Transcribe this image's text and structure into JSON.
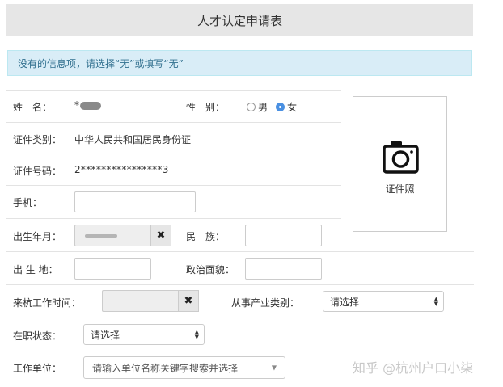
{
  "header": {
    "title": "人才认定申请表"
  },
  "notice": {
    "text": "没有的信息项，请选择“无”或填写“无”"
  },
  "fields": {
    "name": {
      "label": "姓　名：",
      "value": "*"
    },
    "gender": {
      "label": "性　别：",
      "options": [
        "男",
        "女"
      ],
      "selected": "女"
    },
    "id_type": {
      "label": "证件类别：",
      "value": "中华人民共和国居民身份证"
    },
    "id_number": {
      "label": "证件号码：",
      "value": "2****************3"
    },
    "phone": {
      "label": "手机：",
      "value": ""
    },
    "birth_date": {
      "label": "出生年月：",
      "value": "",
      "clear": "✖"
    },
    "ethnicity": {
      "label": "民　族：",
      "value": ""
    },
    "birthplace": {
      "label": "出 生 地：",
      "value": ""
    },
    "political_status": {
      "label": "政治面貌：",
      "value": ""
    },
    "work_start_date": {
      "label": "来杭工作时间：",
      "value": "",
      "clear": "✖"
    },
    "industry": {
      "label": "从事产业类别：",
      "selected": "请选择"
    },
    "employment_status": {
      "label": "在职状态：",
      "selected": "请选择"
    },
    "employer": {
      "label": "工作单位：",
      "placeholder": "请输入单位名称关键字搜索并选择"
    }
  },
  "photo": {
    "label": "证件照",
    "icon": "camera-icon"
  },
  "watermark": {
    "text": "知乎 @杭州户口小柒"
  }
}
